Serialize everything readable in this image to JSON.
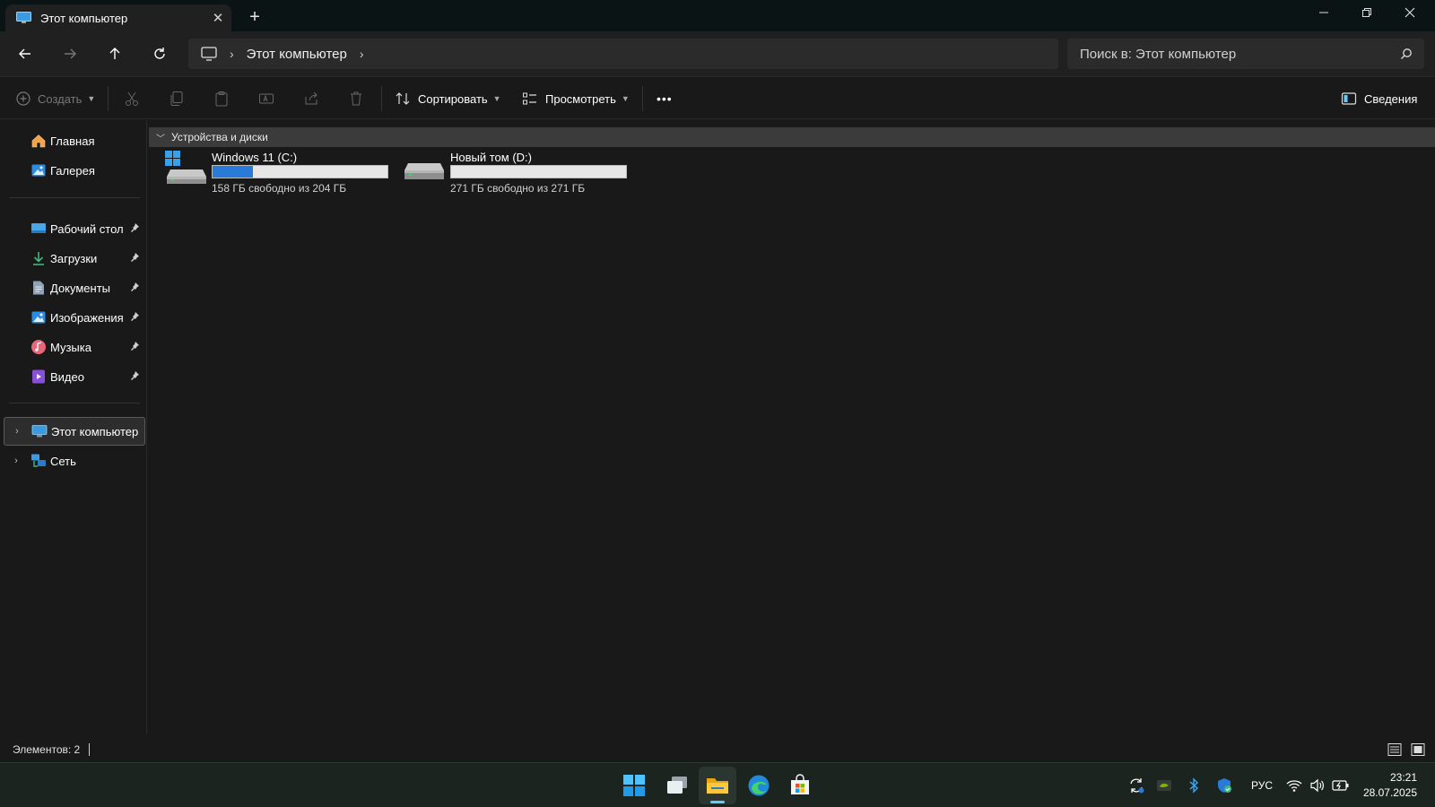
{
  "window": {
    "tab_title": "Этот компьютер",
    "tab_icon": "monitor-icon",
    "close_tab_icon": "close-icon",
    "new_tab_icon": "plus-icon",
    "minimize_icon": "minimize-icon",
    "maximize_icon": "restore-icon",
    "close_icon": "close-icon"
  },
  "nav": {
    "back_icon": "arrow-left-icon",
    "forward_icon": "arrow-right-icon",
    "up_icon": "arrow-up-icon",
    "refresh_icon": "refresh-icon",
    "breadcrumb": {
      "root_icon": "monitor-icon",
      "items": [
        "Этот компьютер"
      ]
    },
    "search_placeholder": "Поиск в: Этот компьютер"
  },
  "commands": {
    "create_label": "Создать",
    "sort_label": "Сортировать",
    "view_label": "Просмотреть",
    "more_label": "•••",
    "details_label": "Сведения"
  },
  "sidebar": {
    "top": [
      {
        "label": "Главная",
        "icon": "home-icon"
      },
      {
        "label": "Галерея",
        "icon": "gallery-icon"
      }
    ],
    "pinned": [
      {
        "label": "Рабочий стол",
        "icon": "desktop-icon"
      },
      {
        "label": "Загрузки",
        "icon": "download-icon"
      },
      {
        "label": "Документы",
        "icon": "document-icon"
      },
      {
        "label": "Изображения",
        "icon": "pictures-icon"
      },
      {
        "label": "Музыка",
        "icon": "music-icon"
      },
      {
        "label": "Видео",
        "icon": "video-icon"
      }
    ],
    "tree": [
      {
        "label": "Этот компьютер",
        "icon": "monitor-icon",
        "selected": true
      },
      {
        "label": "Сеть",
        "icon": "network-icon",
        "selected": false
      }
    ]
  },
  "content": {
    "group_title": "Устройства и диски",
    "drives": [
      {
        "name": "Windows 11 (C:)",
        "free_text": "158 ГБ свободно из 204 ГБ",
        "used_fraction": 0.23,
        "icon": "windows-drive-icon"
      },
      {
        "name": "Новый том (D:)",
        "free_text": "271 ГБ свободно из 271 ГБ",
        "used_fraction": 0.0,
        "icon": "drive-icon"
      }
    ]
  },
  "status": {
    "items_text": "Элементов: 2"
  },
  "taskbar": {
    "apps": [
      "start-icon",
      "task-view-icon",
      "file-explorer-icon",
      "edge-icon",
      "store-icon"
    ],
    "language": "РУС",
    "time": "23:21",
    "date": "28.07.2025"
  },
  "colors": {
    "accent": "#2a7ad8",
    "background": "#191919"
  }
}
